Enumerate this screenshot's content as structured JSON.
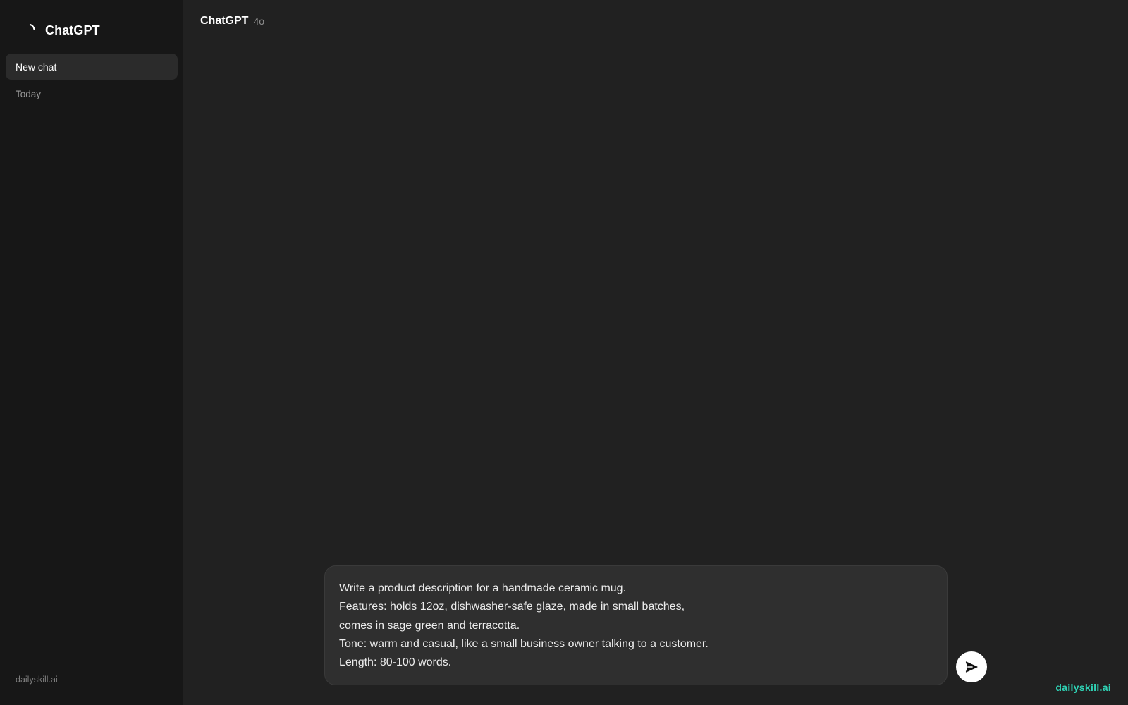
{
  "sidebar": {
    "brand": {
      "name": "ChatGPT",
      "icon": "spinner-logo-icon"
    },
    "new_chat_label": "New chat",
    "section_today": "Today",
    "footer_text": "dailyskill.ai"
  },
  "header": {
    "title": "ChatGPT",
    "model": "4o"
  },
  "composer": {
    "lines": [
      "Write a product description for a handmade ceramic mug.",
      "Features: holds 12oz, dishwasher-safe glaze, made in small batches,",
      "comes in sage green and terracotta.",
      "Tone: warm and casual, like a small business owner talking to a customer.",
      "Length: 80-100 words."
    ],
    "send_icon": "send-arrow-icon"
  },
  "watermark": "dailyskill.ai",
  "colors": {
    "sidebar_bg": "#171717",
    "main_bg": "#212121",
    "composer_bg": "#2f2f2f",
    "accent_watermark": "#2fd3b5"
  }
}
